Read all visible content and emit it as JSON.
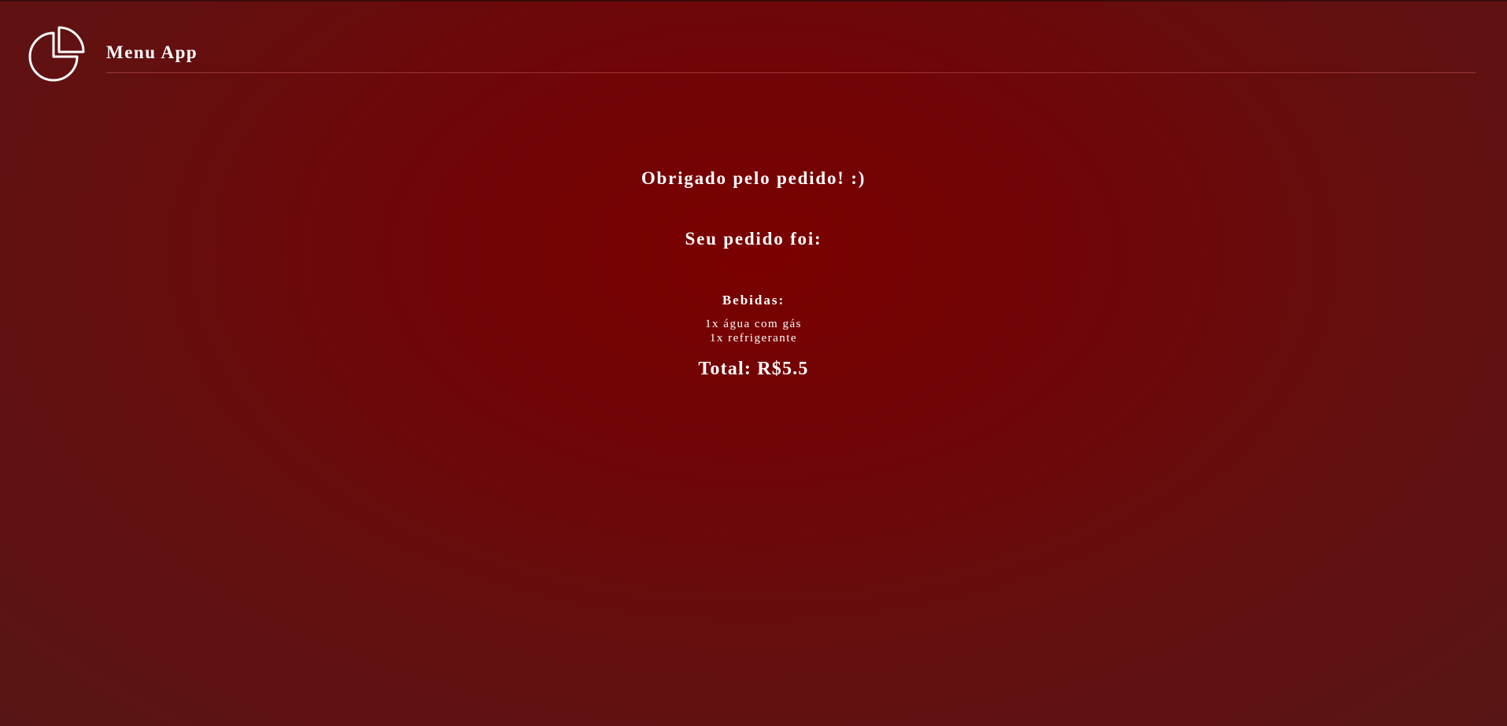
{
  "header": {
    "logo_icon": "pie-chart-icon",
    "title": "Menu App"
  },
  "main": {
    "thanks_message": "Obrigado pelo pedido! :)",
    "order_heading": "Seu pedido foi:",
    "categories": [
      {
        "label": "Bebidas:",
        "items": [
          "1x água com gás",
          "1x refrigerante"
        ]
      }
    ],
    "total": "Total: R$5.5"
  },
  "colors": {
    "background_center": "#7a0000",
    "background_edge": "#581515",
    "text": "#ffffff"
  }
}
